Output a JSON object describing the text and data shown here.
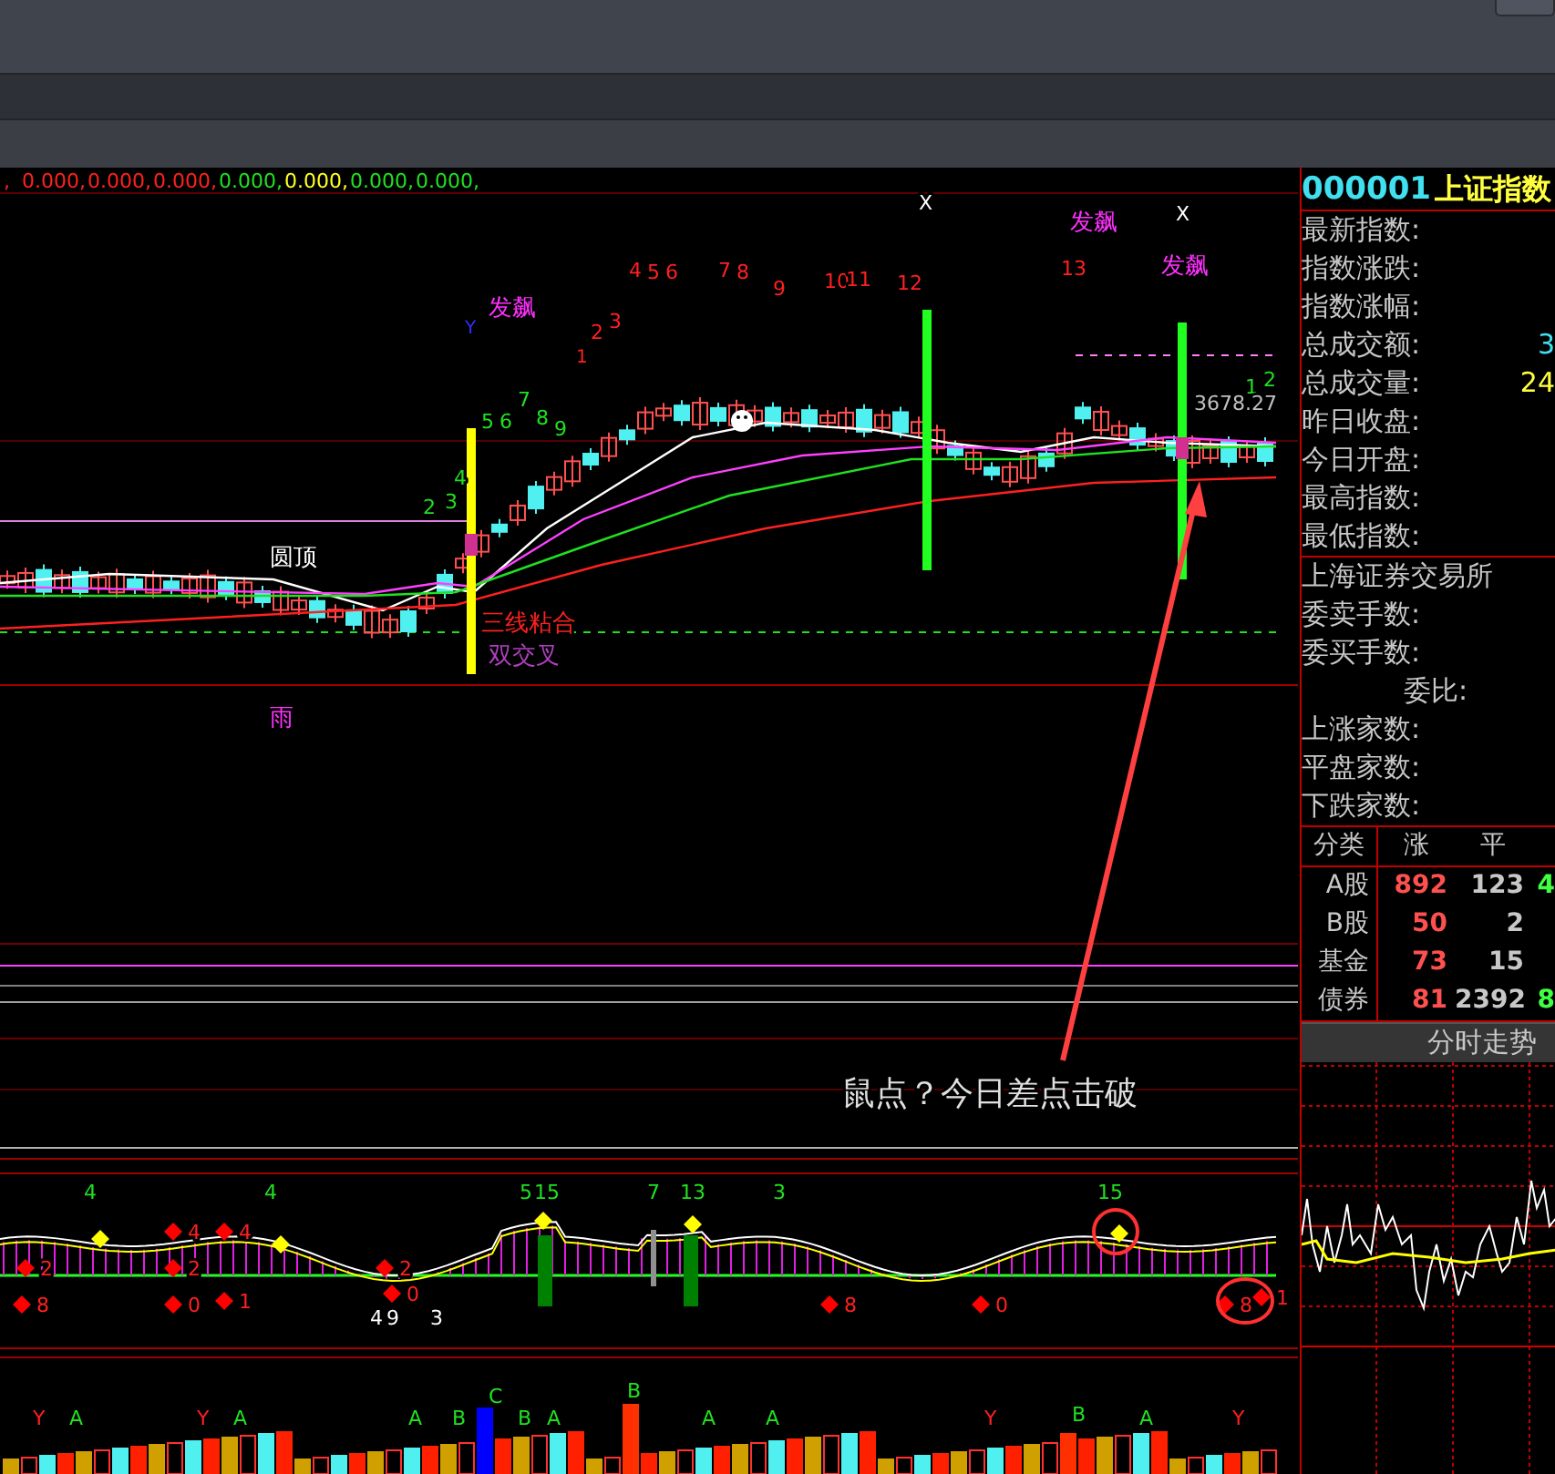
{
  "legend": [
    {
      "text": ",",
      "color": "#ff2020"
    },
    {
      "text": "0.000,",
      "color": "#ff2020"
    },
    {
      "text": "0.000,",
      "color": "#ff2020"
    },
    {
      "text": "0.000,",
      "color": "#ff2020"
    },
    {
      "text": "0.000,",
      "color": "#20e020"
    },
    {
      "text": "0.000,",
      "color": "#ffff20"
    },
    {
      "text": "0.000,",
      "color": "#20e020"
    },
    {
      "text": "0.000,",
      "color": "#20e020"
    }
  ],
  "main_chart": {
    "labels": [
      {
        "text": "X",
        "color": "#ffffff"
      },
      {
        "text": "X",
        "color": "#ffffff"
      },
      {
        "text": "发飙",
        "color": "#ff30ff"
      },
      {
        "text": "发飙",
        "color": "#ff30ff"
      },
      {
        "text": "发飙",
        "color": "#ff30ff"
      },
      {
        "text": "Y",
        "color": "#3030ff"
      },
      {
        "text": "1",
        "color": "#ff2020"
      },
      {
        "text": "2",
        "color": "#ff2020"
      },
      {
        "text": "3",
        "color": "#ff2020"
      },
      {
        "text": "4",
        "color": "#ff2020"
      },
      {
        "text": "5",
        "color": "#ff2020"
      },
      {
        "text": "6",
        "color": "#ff2020"
      },
      {
        "text": "7",
        "color": "#ff2020"
      },
      {
        "text": "8",
        "color": "#ff2020"
      },
      {
        "text": "9",
        "color": "#ff2020"
      },
      {
        "text": "10",
        "color": "#ff2020"
      },
      {
        "text": "11",
        "color": "#ff2020"
      },
      {
        "text": "12",
        "color": "#ff2020"
      },
      {
        "text": "13",
        "color": "#ff2020"
      },
      {
        "text": "2",
        "color": "#20e020"
      },
      {
        "text": "3",
        "color": "#20e020"
      },
      {
        "text": "4",
        "color": "#20e020"
      },
      {
        "text": "5",
        "color": "#20e020"
      },
      {
        "text": "6",
        "color": "#20e020"
      },
      {
        "text": "7",
        "color": "#20e020"
      },
      {
        "text": "8",
        "color": "#20e020"
      },
      {
        "text": "9",
        "color": "#20e020"
      },
      {
        "text": "1",
        "color": "#20e020"
      },
      {
        "text": "2",
        "color": "#20e020"
      },
      {
        "text": "3678.27",
        "color": "#c0c0c0"
      },
      {
        "text": "圆顶",
        "color": "#ffffff"
      },
      {
        "text": "三线粘合",
        "color": "#ff2020"
      },
      {
        "text": "双交叉",
        "color": "#b040c0"
      },
      {
        "text": "雨",
        "color": "#ff30ff"
      }
    ]
  },
  "note": {
    "text": "鼠点？今日差点击破"
  },
  "indicator_chart": {
    "labels": [
      {
        "text": "4",
        "color": "#20e020"
      },
      {
        "text": "4",
        "color": "#20e020"
      },
      {
        "text": "5",
        "color": "#20e020"
      },
      {
        "text": "15",
        "color": "#20e020"
      },
      {
        "text": "7",
        "color": "#20e020"
      },
      {
        "text": "13",
        "color": "#20e020"
      },
      {
        "text": "3",
        "color": "#20e020"
      },
      {
        "text": "15",
        "color": "#20e020"
      },
      {
        "text": "2",
        "color": "#ff2020"
      },
      {
        "text": "8",
        "color": "#ff2020"
      },
      {
        "text": "4",
        "color": "#ff2020"
      },
      {
        "text": "2",
        "color": "#ff2020"
      },
      {
        "text": "0",
        "color": "#ff2020"
      },
      {
        "text": "4",
        "color": "#ff2020"
      },
      {
        "text": "1",
        "color": "#ff2020"
      },
      {
        "text": "2",
        "color": "#ff2020"
      },
      {
        "text": "0",
        "color": "#ff2020"
      },
      {
        "text": "4",
        "color": "#ffffff"
      },
      {
        "text": "9",
        "color": "#ffffff"
      },
      {
        "text": "3",
        "color": "#ffffff"
      },
      {
        "text": "8",
        "color": "#ff2020"
      },
      {
        "text": "0",
        "color": "#ff2020"
      },
      {
        "text": "8",
        "color": "#ff2020"
      },
      {
        "text": "1",
        "color": "#ff2020"
      }
    ]
  },
  "volume_chart": {
    "labels": [
      {
        "text": "Y",
        "color": "#ff2020"
      },
      {
        "text": "A",
        "color": "#20e020"
      },
      {
        "text": "Y",
        "color": "#ff2020"
      },
      {
        "text": "A",
        "color": "#20e020"
      },
      {
        "text": "A",
        "color": "#20e020"
      },
      {
        "text": "B",
        "color": "#20e020"
      },
      {
        "text": "C",
        "color": "#20e020"
      },
      {
        "text": "B",
        "color": "#20e020"
      },
      {
        "text": "A",
        "color": "#20e020"
      },
      {
        "text": "B",
        "color": "#20e020"
      },
      {
        "text": "A",
        "color": "#20e020"
      },
      {
        "text": "A",
        "color": "#20e020"
      },
      {
        "text": "Y",
        "color": "#ff2020"
      },
      {
        "text": "B",
        "color": "#20e020"
      },
      {
        "text": "A",
        "color": "#20e020"
      },
      {
        "text": "Y",
        "color": "#ff2020"
      }
    ]
  },
  "quote_panel": {
    "code": "000001",
    "name": "上证指数",
    "fields": [
      {
        "label": "最新指数:"
      },
      {
        "label": "指数涨跌:"
      },
      {
        "label": "指数涨幅:"
      },
      {
        "label": "总成交额:",
        "value": "3",
        "color": "#40e0f0"
      },
      {
        "label": "总成交量:",
        "value": "24",
        "color": "#ffff40"
      },
      {
        "label": "昨日收盘:"
      },
      {
        "label": "今日开盘:"
      },
      {
        "label": "最高指数:"
      },
      {
        "label": "最低指数:"
      }
    ]
  },
  "exchange": {
    "title": "上海证券交易所",
    "fields": [
      {
        "label": "委卖手数:"
      },
      {
        "label": "委买手数:"
      },
      {
        "label": "委比:"
      },
      {
        "label": "上涨家数:"
      },
      {
        "label": "平盘家数:"
      },
      {
        "label": "下跌家数:"
      }
    ]
  },
  "breadth": {
    "columns": [
      "分类",
      "涨",
      "平"
    ],
    "rows": [
      {
        "cells": [
          "A股",
          "892",
          "123",
          "4"
        ]
      },
      {
        "cells": [
          "B股",
          "50",
          "2"
        ]
      },
      {
        "cells": [
          "基金",
          "73",
          "15"
        ]
      },
      {
        "cells": [
          "债券",
          "81",
          "2392",
          "8"
        ]
      }
    ]
  },
  "intraday": {
    "title": "分时走势"
  }
}
